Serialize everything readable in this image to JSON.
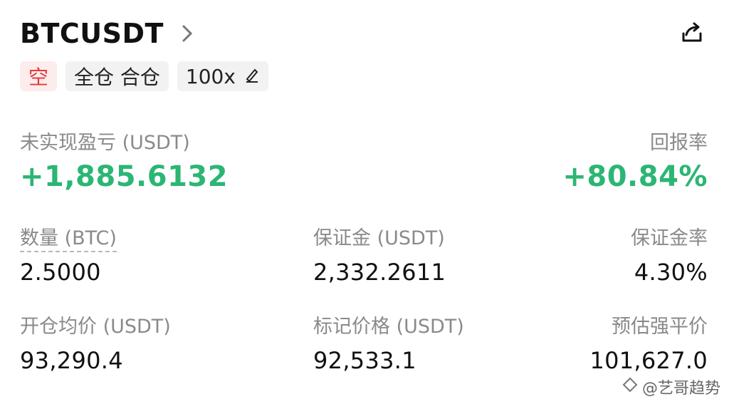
{
  "header": {
    "symbol": "BTCUSDT"
  },
  "tags": {
    "direction": "空",
    "margin_mode": "全仓 合仓",
    "leverage": "100x"
  },
  "pnl": {
    "unrealized_label": "未实现盈亏 (USDT)",
    "unrealized_value": "+1,885.6132",
    "roe_label": "回报率",
    "roe_value": "+80.84%"
  },
  "stats": {
    "qty_label": "数量 (BTC)",
    "qty_value": "2.5000",
    "margin_label": "保证金 (USDT)",
    "margin_value": "2,332.2611",
    "margin_rate_label": "保证金率",
    "margin_rate_value": "4.30%",
    "entry_label": "开仓均价 (USDT)",
    "entry_value": "93,290.4",
    "mark_label": "标记价格 (USDT)",
    "mark_value": "92,533.1",
    "liq_label": "预估强平价",
    "liq_value": "101,627.0"
  },
  "watermark": {
    "text": "@艺哥趋势"
  },
  "colors": {
    "profit": "#2bb674",
    "short": "#e23b3b"
  },
  "icons": {
    "title_chevron": "chevron-right-icon",
    "share": "share-icon",
    "edit": "pencil-icon"
  }
}
